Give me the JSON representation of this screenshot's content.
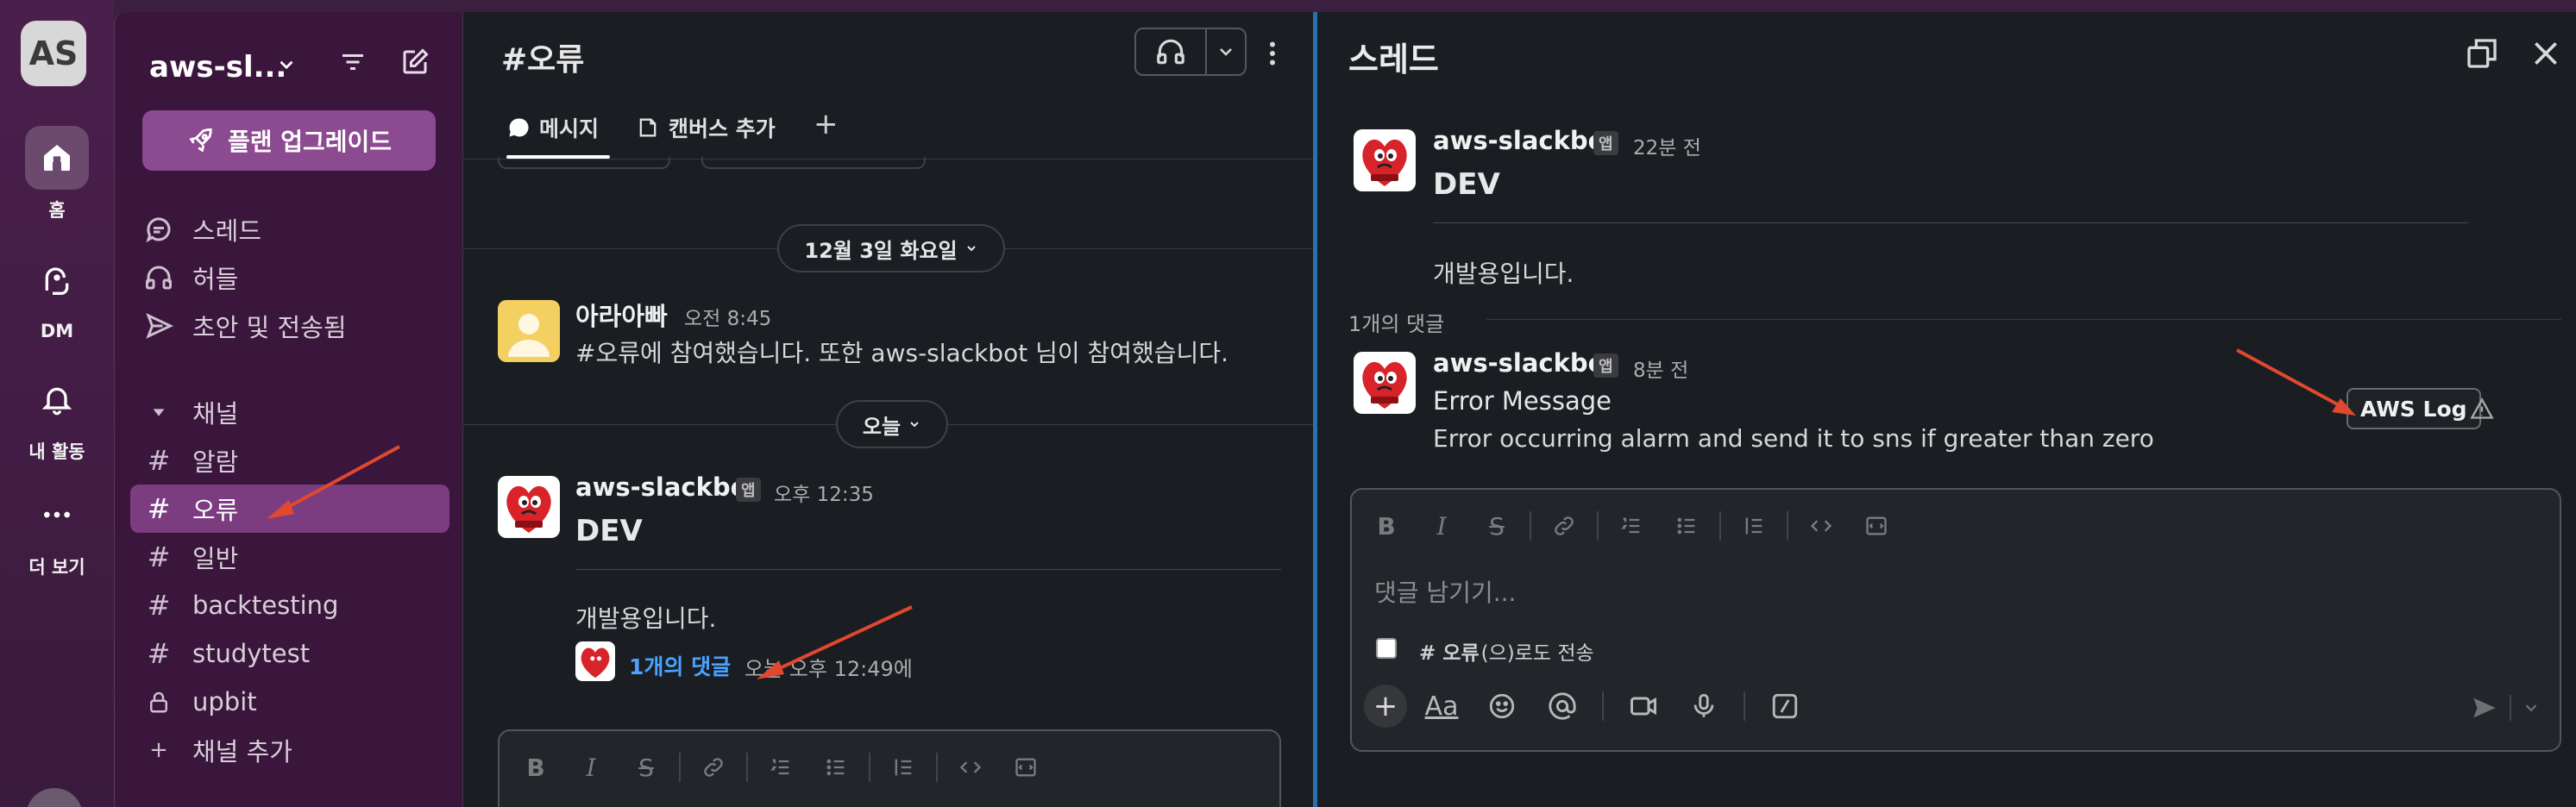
{
  "rail": {
    "workspace_initials": "AS",
    "items": [
      {
        "label": "홈",
        "icon": "home-icon",
        "active": true
      },
      {
        "label": "DM",
        "icon": "dm-icon"
      },
      {
        "label": "내 활동",
        "icon": "bell-icon"
      },
      {
        "label": "더 보기",
        "icon": "more-icon"
      }
    ]
  },
  "sidebar": {
    "workspace_name": "aws-sl...",
    "upgrade_label": "플랜 업그레이드",
    "nav": [
      {
        "label": "스레드",
        "icon": "threads-icon"
      },
      {
        "label": "허들",
        "icon": "headphones-icon"
      },
      {
        "label": "초안 및 전송됨",
        "icon": "send-icon"
      }
    ],
    "channels_header": "채널",
    "channels": [
      {
        "label": "알람"
      },
      {
        "label": "오류",
        "active": true
      },
      {
        "label": "일반"
      },
      {
        "label": "backtesting"
      },
      {
        "label": "studytest"
      },
      {
        "label": "upbit",
        "icon": "lock-icon"
      }
    ],
    "add_channel": "채널 추가"
  },
  "channel": {
    "title": "#오류",
    "tabs": [
      {
        "label": "메시지",
        "icon": "message-icon"
      },
      {
        "label": "캔버스 추가",
        "icon": "canvas-icon"
      }
    ],
    "date_divider_1": "12월 3일 화요일",
    "date_divider_2": "오늘",
    "messages": [
      {
        "author": "아라아빠",
        "time": "오전 8:45",
        "text": "#오류에 참여했습니다. 또한 aws-slackbot 님이 참여했습니다."
      },
      {
        "author": "aws-slackbot",
        "badge": "앱",
        "time": "오후 12:35",
        "title": "DEV",
        "text": "개발용입니다.",
        "replies_label": "1개의 댓글",
        "replies_time": "오늘 오후 12:49에"
      }
    ]
  },
  "thread": {
    "title": "스레드",
    "parent": {
      "author": "aws-slackbot",
      "badge": "앱",
      "time": "22분 전",
      "title": "DEV",
      "text": "개발용입니다."
    },
    "reply_count": "1개의 댓글",
    "reply": {
      "author": "aws-slackbot",
      "badge": "앱",
      "time": "8분 전",
      "title": "Error Message",
      "text": "Error occurring alarm and send it to sns if greater than zero",
      "button_label": "AWS Log"
    },
    "composer": {
      "placeholder": "댓글 남기기...",
      "also_send_channel": "# 오류",
      "also_send_suffix": "(으)로도 전송"
    }
  },
  "colors": {
    "accent_purple": "#8c4a90",
    "active_channel": "#7c3d80",
    "link_blue": "#4aa3ff",
    "annotation_arrow": "#e0482f"
  }
}
